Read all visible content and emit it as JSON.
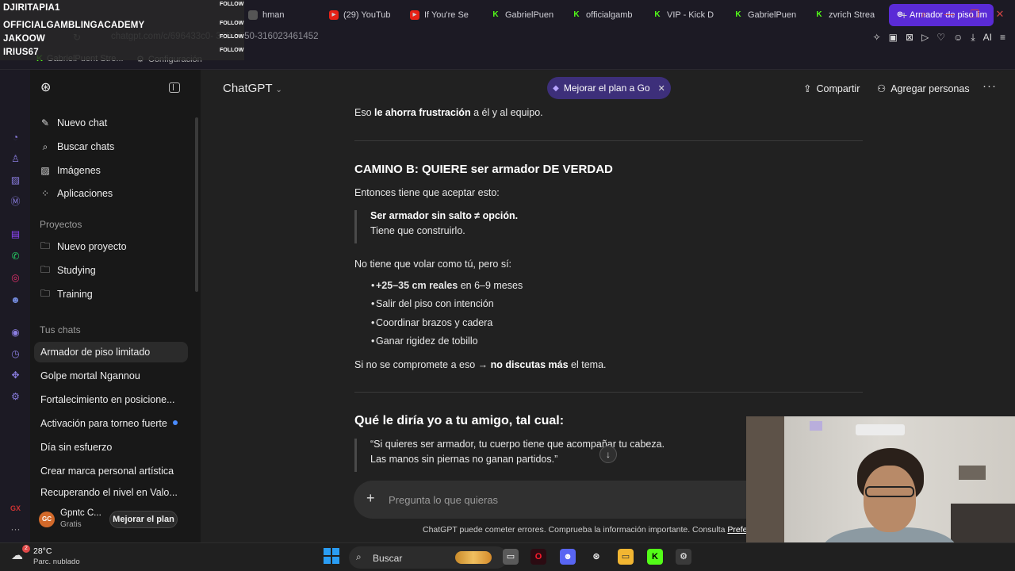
{
  "stream_overlay": {
    "names": [
      "DJIRITAPIA1",
      "OFFICIALGAMBLINGACADEMY",
      "JAKOOW",
      "IRIUS67"
    ],
    "follow_label": "FOLLOW"
  },
  "browser": {
    "tabs": [
      {
        "label": "hman",
        "icon": "tab-icon"
      },
      {
        "label": "(29) YouTub",
        "icon": "youtube-icon"
      },
      {
        "label": "If You're Se",
        "icon": "youtube-icon"
      },
      {
        "label": "GabrielPuen",
        "icon": "kick-icon"
      },
      {
        "label": "officialgamb",
        "icon": "kick-icon"
      },
      {
        "label": "VIP - Kick D",
        "icon": "kick-icon"
      },
      {
        "label": "GabrielPuen",
        "icon": "kick-icon"
      },
      {
        "label": "zvrich Strea",
        "icon": "kick-icon"
      },
      {
        "label": "Armador de piso limita",
        "icon": "chatgpt-icon",
        "active": true
      }
    ],
    "url": "chatgpt.com/c/696433c0-      329-b350-316023461452",
    "toolbar_ai_label": "AI",
    "bookmarks": [
      {
        "label": "GabrielPuent Stre...",
        "icon": "kick-icon"
      },
      {
        "label": "Configuración",
        "icon": "gear-icon"
      }
    ]
  },
  "sidebar": {
    "top_items": [
      {
        "label": "Nuevo chat",
        "icon": "edit-icon"
      },
      {
        "label": "Buscar chats",
        "icon": "search-icon"
      },
      {
        "label": "Imágenes",
        "icon": "image-icon"
      },
      {
        "label": "Aplicaciones",
        "icon": "apps-icon"
      }
    ],
    "projects_title": "Proyectos",
    "projects": [
      {
        "label": "Nuevo proyecto",
        "icon": "folder-plus-icon"
      },
      {
        "label": "Studying",
        "icon": "folder-icon"
      },
      {
        "label": "Training",
        "icon": "folder-icon"
      }
    ],
    "chats_title": "Tus chats",
    "chats": [
      {
        "label": "Armador de piso limitado",
        "active": true
      },
      {
        "label": "Golpe mortal Ngannou"
      },
      {
        "label": "Fortalecimiento en posicione..."
      },
      {
        "label": "Activación para torneo fuerte",
        "unread": true
      },
      {
        "label": "Día sin esfuerzo"
      },
      {
        "label": "Crear marca personal artística"
      },
      {
        "label": "Recuperando el nivel en Valo..."
      }
    ],
    "user": {
      "initials": "GC",
      "name": "Gpntc C...",
      "plan": "Gratis",
      "upgrade_label": "Mejorar el plan"
    }
  },
  "header": {
    "model": "ChatGPT",
    "upgrade_pill": "Mejorar el plan a Go",
    "share": "Compartir",
    "add_people": "Agregar personas"
  },
  "conversation": {
    "line1_pre": "Eso ",
    "line1_bold": "le ahorra frustración",
    "line1_post": " a él y al equipo.",
    "camino_b_title": "CAMINO B: QUIERE ser armador DE VERDAD",
    "accept_line": "Entonces tiene que aceptar esto:",
    "quote1_bold": "Ser armador sin salto ≠ opción.",
    "quote1_line2": "Tiene que construirlo.",
    "no_volar": "No tiene que volar como tú, pero sí:",
    "bullets": [
      {
        "bold": "+25–35 cm reales",
        "rest": " en 6–9 meses"
      },
      {
        "bold": "",
        "rest": "Salir del piso con intención"
      },
      {
        "bold": "",
        "rest": "Coordinar brazos y cadera"
      },
      {
        "bold": "",
        "rest": "Ganar rigidez de tobillo"
      }
    ],
    "final_pre": "Si no se compromete a eso → ",
    "final_bold": "no discutas más",
    "final_post": " el tema.",
    "amigo_title": "Qué le diría yo a tu amigo, tal cual:",
    "quote2_line1": "“Si quieres ser armador, tu cuerpo tiene que acompañar tu cabeza.",
    "quote2_line2": "Las manos sin piernas no ganan partidos.”"
  },
  "composer": {
    "placeholder": "Pregunta lo que quieras"
  },
  "disclaimer": {
    "text": "ChatGPT puede cometer errores. Comprueba la información importante. Consulta ",
    "link": "Preferencia"
  },
  "taskbar": {
    "temperature": "28°C",
    "condition": "Parc. nublado",
    "weather_badge": "2",
    "search_label": "Buscar"
  },
  "colors": {
    "accent": "#5a2bd6",
    "upgrade_pill": "#3d2f7a",
    "unread_dot": "#4a8cff",
    "avatar": "#d2692a"
  }
}
